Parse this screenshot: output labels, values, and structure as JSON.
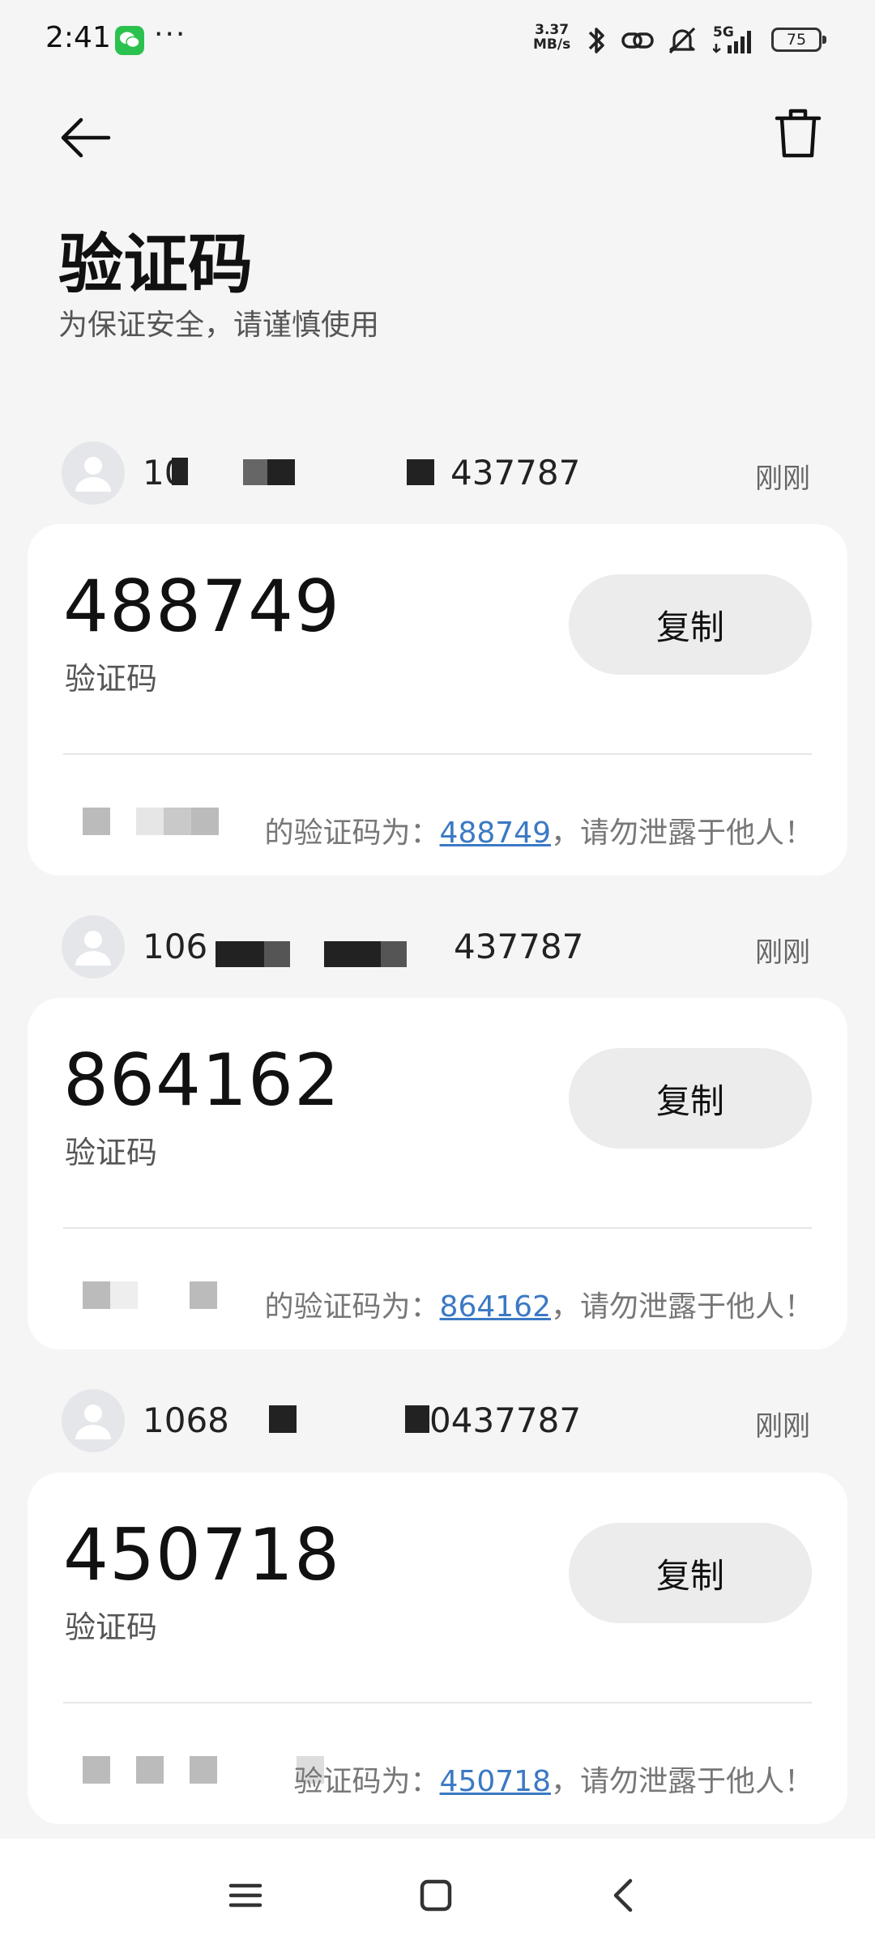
{
  "status_bar": {
    "time": "2:41",
    "more": "···",
    "speed_top": "3.37",
    "speed_bottom": "MB/s",
    "network": "5G",
    "battery": "75"
  },
  "header": {
    "title": "验证码",
    "subtitle": "为保证安全，请谨慎使用"
  },
  "colors": {
    "background": "#f5f5f5",
    "card": "#ffffff",
    "copy_button": "#ececec",
    "link": "#3b79c4",
    "wechat": "#2bc14e"
  },
  "messages": [
    {
      "sender": "10",
      "sender_tail": "437787",
      "time": "刚刚",
      "code": "488749",
      "code_label": "验证码",
      "copy_label": "复制",
      "body_prefix": "的验证码为：",
      "body_code": "488749",
      "body_suffix": "，请勿泄露于他人！"
    },
    {
      "sender": "106",
      "sender_tail": "437787",
      "time": "刚刚",
      "code": "864162",
      "code_label": "验证码",
      "copy_label": "复制",
      "body_prefix": "的验证码为：",
      "body_code": "864162",
      "body_suffix": "，请勿泄露于他人！"
    },
    {
      "sender": "1068",
      "sender_tail": "0437787",
      "time": "刚刚",
      "code": "450718",
      "code_label": "验证码",
      "copy_label": "复制",
      "body_prefix": "验证码为：",
      "body_code": "450718",
      "body_suffix": "，请勿泄露于他人！"
    }
  ],
  "nav": {
    "recents_icon": "menu-icon",
    "home_icon": "home-icon",
    "back_icon": "back-icon"
  }
}
